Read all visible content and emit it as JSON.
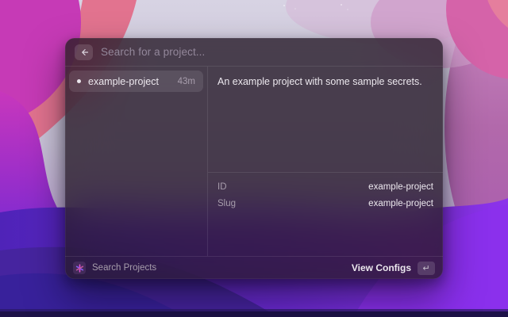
{
  "search": {
    "placeholder": "Search for a project...",
    "back_icon": "arrow-left"
  },
  "list": {
    "items": [
      {
        "title": "example-project",
        "time": "43m",
        "selected": true
      }
    ]
  },
  "detail": {
    "description": "An example project with some sample secrets.",
    "metadata": [
      {
        "label": "ID",
        "value": "example-project"
      },
      {
        "label": "Slug",
        "value": "example-project"
      }
    ]
  },
  "footer": {
    "app_label": "Search Projects",
    "action_label": "View Configs",
    "enter_key": "↵"
  },
  "colors": {
    "selection": "rgba(255,255,255,0.10)",
    "window_tint": "rgba(38,26,39,0.80)",
    "accent_magenta": "#c63ab6",
    "accent_violet": "#7a2ad2",
    "accent_pink": "#e2738f"
  }
}
